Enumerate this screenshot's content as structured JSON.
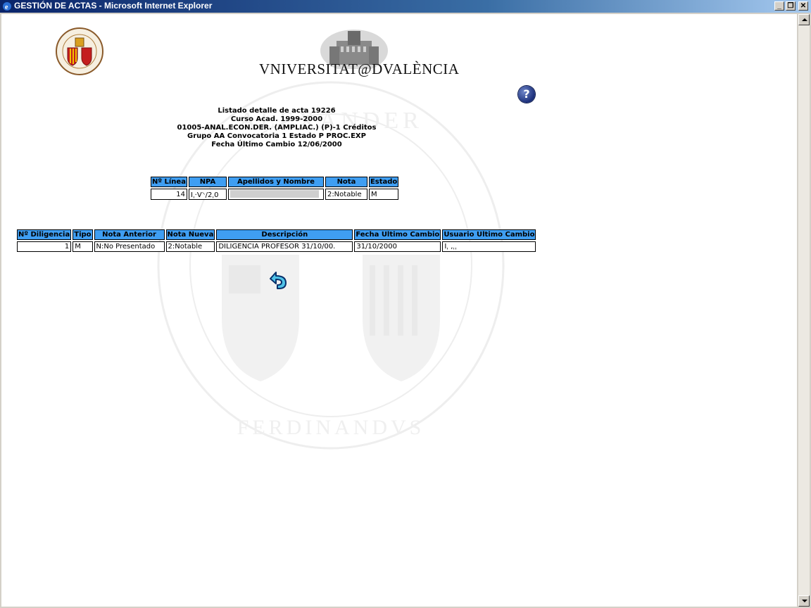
{
  "window": {
    "title": "GESTIÓN DE ACTAS - Microsoft Internet Explorer",
    "buttons": {
      "minimize": "_",
      "restore": "❐",
      "close": "✕"
    }
  },
  "brand": {
    "university": "VNIVERSITAT@DVALÈNCIA"
  },
  "header": {
    "line1": "Listado detalle de acta 19226",
    "line2": "Curso Acad. 1999-2000",
    "line3": "01005-ANAL.ECON.DER. (AMPLIAC.) (P)-1 Créditos",
    "line4": "Grupo AA Convocatoria 1 Estado P PROC.EXP",
    "line5": "Fecha Último Cambio 12/06/2000"
  },
  "student_table": {
    "headers": [
      "Nº Línea",
      "NPA",
      "Apellidos y Nombre",
      "Nota",
      "Estado"
    ],
    "row": {
      "linea": "14",
      "npa": "Iˌ·V⸌/2ˌ0",
      "nombre": "",
      "nota": "2:Notable",
      "estado": "M"
    }
  },
  "diligencia_table": {
    "headers": [
      "Nº Diligencia",
      "Tipo",
      "Nota Anterior",
      "Nota Nueva",
      "Descripción",
      "Fecha Ultimo Cambio",
      "Usuario Ultimo Cambio"
    ],
    "row": {
      "num": "1",
      "tipo": "M",
      "nota_anterior": "N:No Presentado",
      "nota_nueva": "2:Notable",
      "descripcion": "DILIGENCIA PROFESOR 31/10/00.",
      "fecha": "31/10/2000",
      "usuario": "Iˌ ,ˌˌ"
    }
  },
  "icons": {
    "help": "question-mark-icon",
    "back": "return-arrow-icon"
  },
  "help_glyph": "?"
}
